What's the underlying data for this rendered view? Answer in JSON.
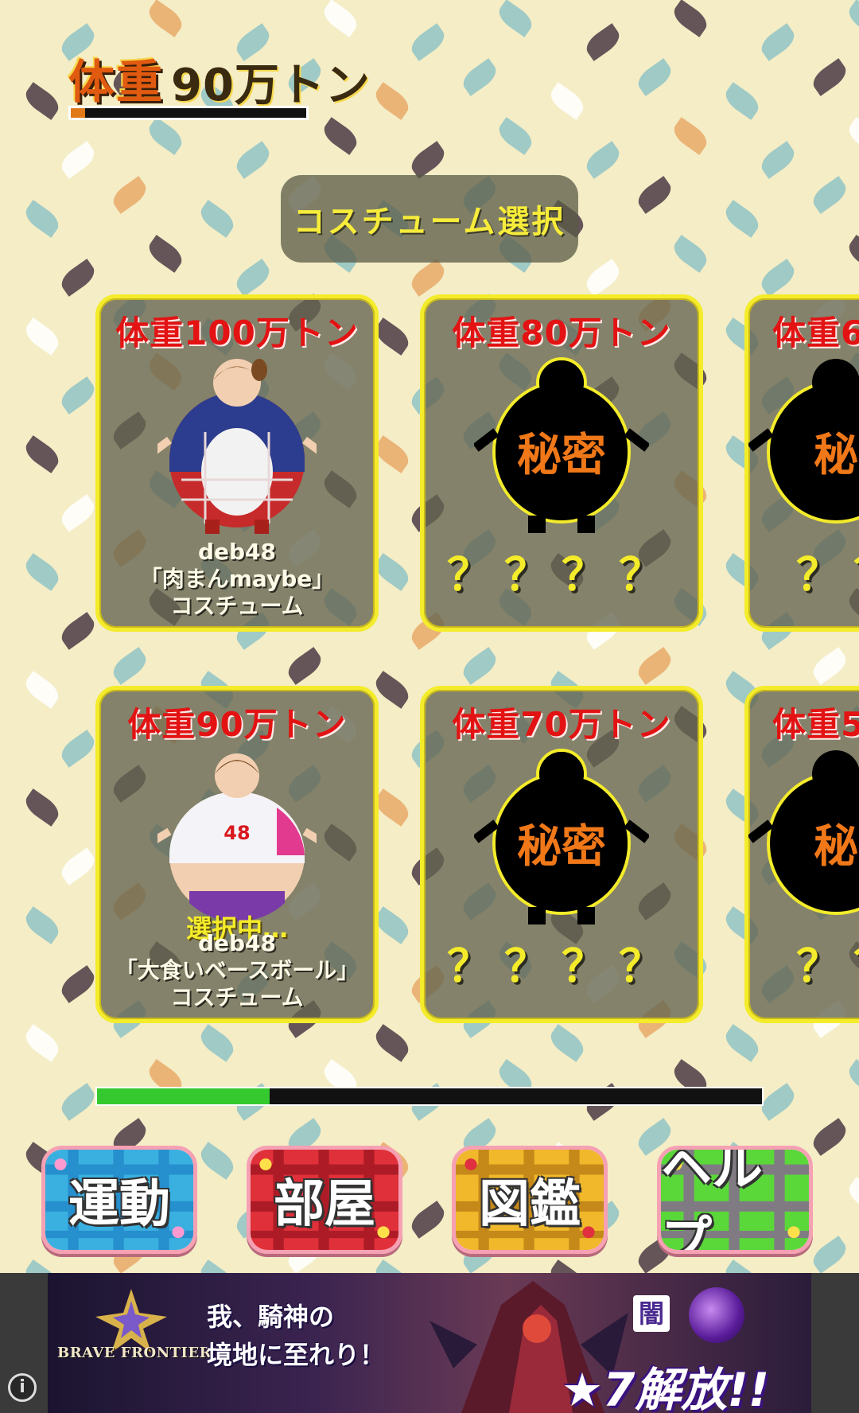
{
  "status": {
    "weight_label": "体重",
    "weight_value": "90万トン",
    "weight_progress": 0.06
  },
  "title": "コスチューム選択",
  "cards": [
    {
      "title": "体重100万トン",
      "unlocked": true,
      "desc_line1": "deb48",
      "desc_line2": "「肉まんmaybe」",
      "desc_line3": "コスチューム"
    },
    {
      "title": "体重80万トン",
      "unlocked": false,
      "secret_label": "秘密",
      "question": "？？？？"
    },
    {
      "title": "体重6",
      "unlocked": false,
      "secret_label": "秘",
      "question": "？？"
    },
    {
      "title": "体重90万トン",
      "unlocked": true,
      "selected_label": "選択中…",
      "desc_line1": "deb48",
      "desc_line2": "「大食いベースボール」",
      "desc_line3": "コスチューム",
      "jersey_number": "48"
    },
    {
      "title": "体重70万トン",
      "unlocked": false,
      "secret_label": "秘密",
      "question": "？？？？"
    },
    {
      "title": "体重5",
      "unlocked": false,
      "secret_label": "秘",
      "question": "？？"
    }
  ],
  "page_progress": 0.26,
  "nav": {
    "exercise": "運動",
    "room": "部屋",
    "book": "図鑑",
    "help": "ヘルプ"
  },
  "ad": {
    "logo": "BRAVE FRONTIER",
    "line1": "我、騎神の",
    "line2": "境地に至れり！",
    "badge": "闇",
    "headline": "★7解放!!",
    "info_icon": "i"
  },
  "colors": {
    "card_border": "#f4ec2a",
    "card_title": "#e31313",
    "progress_fill": "#35c92f",
    "weight_fill": "#e07a18"
  }
}
